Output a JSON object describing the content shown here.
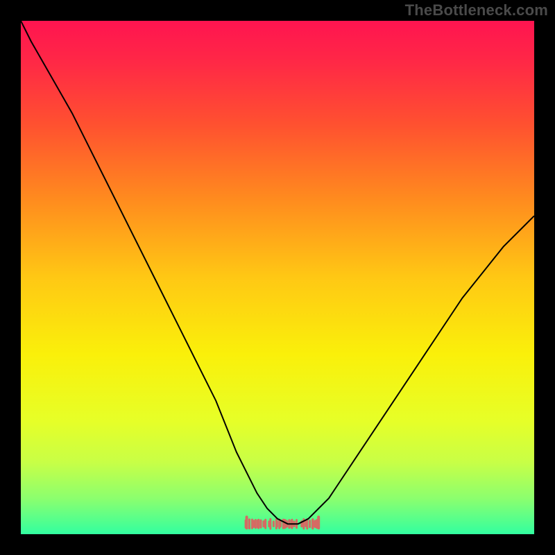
{
  "watermark": "TheBottleneck.com",
  "colors": {
    "frame": "#000000",
    "watermark": "#4a4a4a",
    "curve": "#000000",
    "marker": "#d56a63",
    "gradient_stops": [
      {
        "offset": 0.0,
        "color": "#ff1450"
      },
      {
        "offset": 0.08,
        "color": "#ff2846"
      },
      {
        "offset": 0.2,
        "color": "#ff5030"
      },
      {
        "offset": 0.35,
        "color": "#ff8c1e"
      },
      {
        "offset": 0.5,
        "color": "#ffc814"
      },
      {
        "offset": 0.65,
        "color": "#faf00a"
      },
      {
        "offset": 0.78,
        "color": "#e6ff28"
      },
      {
        "offset": 0.86,
        "color": "#c8ff46"
      },
      {
        "offset": 0.93,
        "color": "#8cff6e"
      },
      {
        "offset": 1.0,
        "color": "#32ffa0"
      }
    ]
  },
  "chart_data": {
    "type": "line",
    "title": "",
    "xlabel": "",
    "ylabel": "",
    "xlim": [
      0,
      100
    ],
    "ylim": [
      0,
      100
    ],
    "grid": false,
    "legend": false,
    "x": [
      0,
      2,
      6,
      10,
      14,
      18,
      22,
      26,
      30,
      34,
      38,
      42,
      44,
      46,
      48,
      50,
      52,
      54,
      56,
      58,
      60,
      62,
      66,
      70,
      74,
      78,
      82,
      86,
      90,
      94,
      98,
      100
    ],
    "series": [
      {
        "name": "bottleneck-curve",
        "values": [
          100,
          96,
          89,
          82,
          74,
          66,
          58,
          50,
          42,
          34,
          26,
          16,
          12,
          8,
          5,
          3,
          2,
          2,
          3,
          5,
          7,
          10,
          16,
          22,
          28,
          34,
          40,
          46,
          51,
          56,
          60,
          62
        ]
      }
    ],
    "markers": {
      "name": "optimal-range",
      "shape": "tick-band",
      "x_range": [
        44,
        58
      ],
      "y": 2,
      "color": "#d56a63"
    }
  }
}
